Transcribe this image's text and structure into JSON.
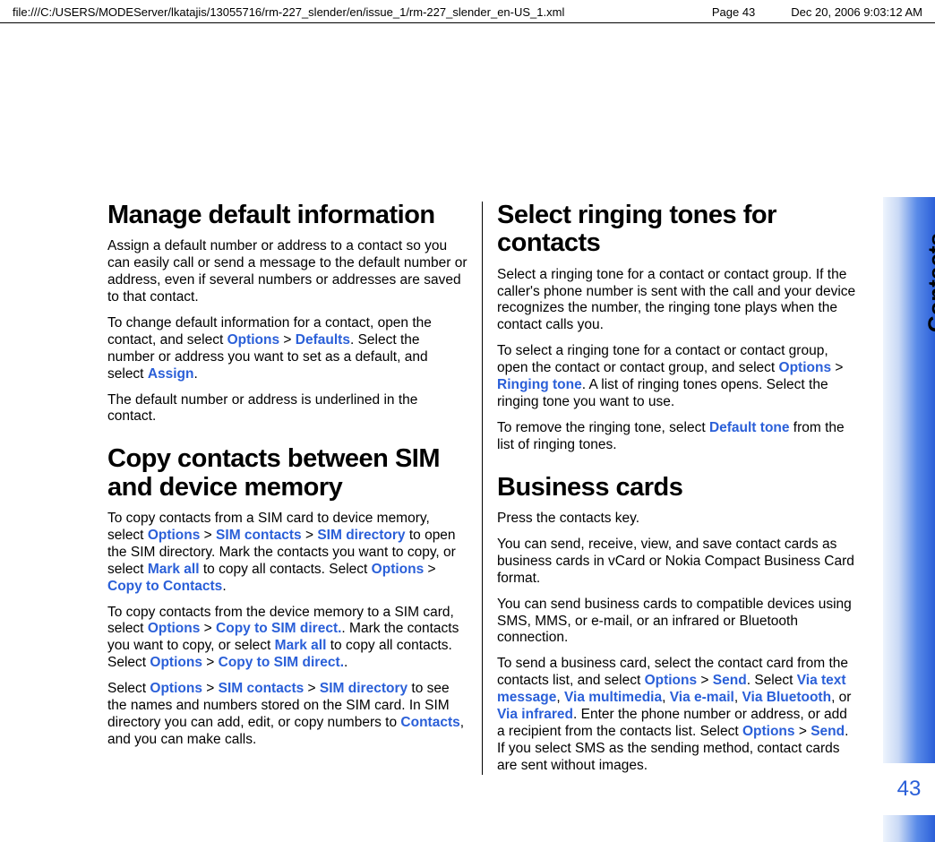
{
  "header": {
    "path": "file:///C:/USERS/MODEServer/lkatajis/13055716/rm-227_slender/en/issue_1/rm-227_slender_en-US_1.xml",
    "page_label": "Page 43",
    "timestamp": "Dec 20, 2006 9:03:12 AM"
  },
  "side": {
    "section": "Contacts",
    "page_number": "43"
  },
  "left": {
    "h1": "Manage default information",
    "p1": "Assign a default number or address to a contact so you can easily call or send a message to the default number or address, even if several numbers or addresses are saved to that contact.",
    "p2a": "To change default information for a contact, open the contact, and select ",
    "p2_k1": "Options",
    "p2_k2": "Defaults",
    "p2b": ". Select the number or address you want to set as a default, and select ",
    "p2_k3": "Assign",
    "p2c": ".",
    "p3": "The default number or address is underlined in the contact.",
    "h2": "Copy contacts between SIM and device memory",
    "p4a": "To copy contacts from a SIM card to device memory, select ",
    "p4_k1": "Options",
    "p4_k2": "SIM contacts",
    "p4_k3": "SIM directory",
    "p4b": " to open the SIM directory. Mark the contacts you want to copy, or select ",
    "p4_k4": "Mark all",
    "p4c": " to copy all contacts. Select ",
    "p4_k5": "Options",
    "p4_k6": "Copy to Contacts",
    "p4d": ".",
    "p5a": "To copy contacts from the device memory to a SIM card, select ",
    "p5_k1": "Options",
    "p5_k2": "Copy to SIM direct.",
    "p5b": ". Mark the contacts you want to copy, or select ",
    "p5_k3": "Mark all",
    "p5c": " to copy all contacts. Select ",
    "p5_k4": "Options",
    "p5_k5": "Copy to SIM direct.",
    "p5d": ".",
    "p6a": "Select ",
    "p6_k1": "Options",
    "p6_k2": "SIM contacts",
    "p6_k3": "SIM directory",
    "p6b": " to see the names and numbers stored on the SIM card. In SIM directory you can add, edit, or copy numbers to ",
    "p6_k4": "Contacts",
    "p6c": ", and you can make calls."
  },
  "right": {
    "h1": "Select ringing tones for contacts",
    "p1": "Select a ringing tone for a contact or contact group. If the caller's phone number is sent with the call and your device recognizes the number, the ringing tone plays when the contact calls you.",
    "p2a": "To select a ringing tone for a contact or contact group, open the contact or contact group, and select ",
    "p2_k1": "Options",
    "p2_k2": "Ringing tone",
    "p2b": ". A list of ringing tones opens. Select the ringing tone you want to use.",
    "p3a": "To remove the ringing tone, select ",
    "p3_k1": "Default tone",
    "p3b": " from the list of ringing tones.",
    "h2": "Business cards",
    "p4": "Press the contacts key.",
    "p5": "You can send, receive, view, and save contact cards as business cards in vCard or Nokia Compact Business Card format.",
    "p6": "You can send business cards to compatible devices using SMS, MMS, or e-mail, or an infrared or Bluetooth connection.",
    "p7a": "To send a business card, select the contact card from the contacts list, and select ",
    "p7_k1": "Options",
    "p7_k2": "Send",
    "p7b": ". Select ",
    "p7_k3": "Via text message",
    "p7_k4": "Via multimedia",
    "p7_k5": "Via e-mail",
    "p7_k6": "Via Bluetooth",
    "p7_k7": "Via infrared",
    "p7c": ". Enter the phone number or address, or add a recipient from the contacts list. Select ",
    "p7_k8": "Options",
    "p7_k9": "Send",
    "p7d": ". If you select SMS as the sending method, contact cards are sent without images."
  },
  "sep": {
    "gt": " > ",
    "comma": ", ",
    "or": ", or "
  }
}
